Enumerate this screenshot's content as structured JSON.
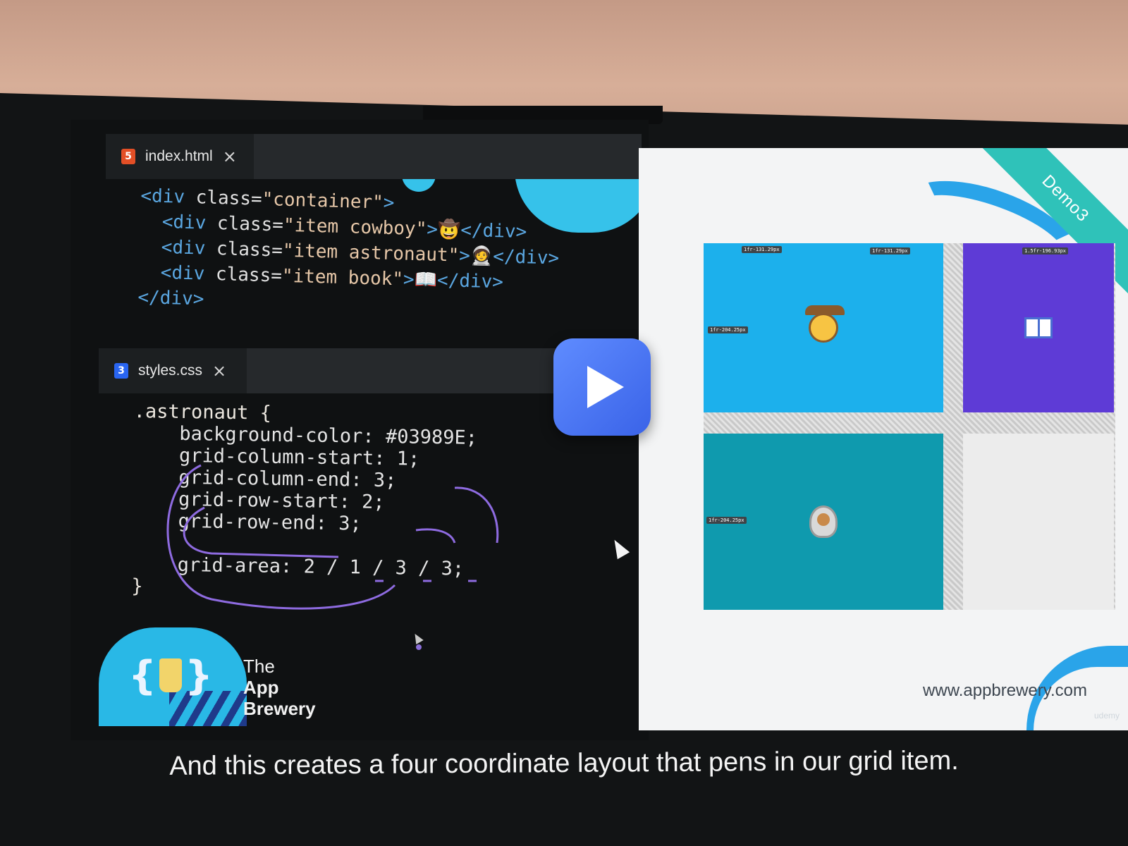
{
  "editor": {
    "html_tab": {
      "icon": "html5-icon",
      "icon_glyph": "5",
      "name": "index.html",
      "close": "×"
    },
    "css_tab": {
      "icon": "css3-icon",
      "icon_glyph": "3",
      "name": "styles.css",
      "close": "×"
    },
    "html_lines": [
      "<div class=\"container\">",
      "  <div class=\"item cowboy\">🤠</div>",
      "  <div class=\"item astronaut\">🧑‍🚀</div>",
      "  <div class=\"item book\">📖</div>",
      "</div>"
    ],
    "css_lines": [
      ".astronaut {",
      "    background-color: #03989E;",
      "    grid-column-start: 1;",
      "    grid-column-end: 3;",
      "    grid-row-start: 2;",
      "    grid-row-end: 3;",
      "",
      "    grid-area: 2 / 1 / 3 / 3;",
      "}"
    ]
  },
  "brand": {
    "the": "The",
    "name": "App Brewery"
  },
  "demo": {
    "corner_label": "Demo3",
    "url": "www.appbrewery.com",
    "watermark": "udemy",
    "track_labels": [
      "1fr-131.29px",
      "1fr-131.29px",
      "1.5fr-196.93px",
      "1fr-204.25px",
      "1fr-204.25px"
    ],
    "colors": {
      "cowboy": "#1cb0ec",
      "book": "#5e3bd6",
      "astronaut": "#0f9aae"
    }
  },
  "player": {
    "icon": "play-icon"
  },
  "caption": "And this creates a four coordinate layout that pens in our grid item."
}
